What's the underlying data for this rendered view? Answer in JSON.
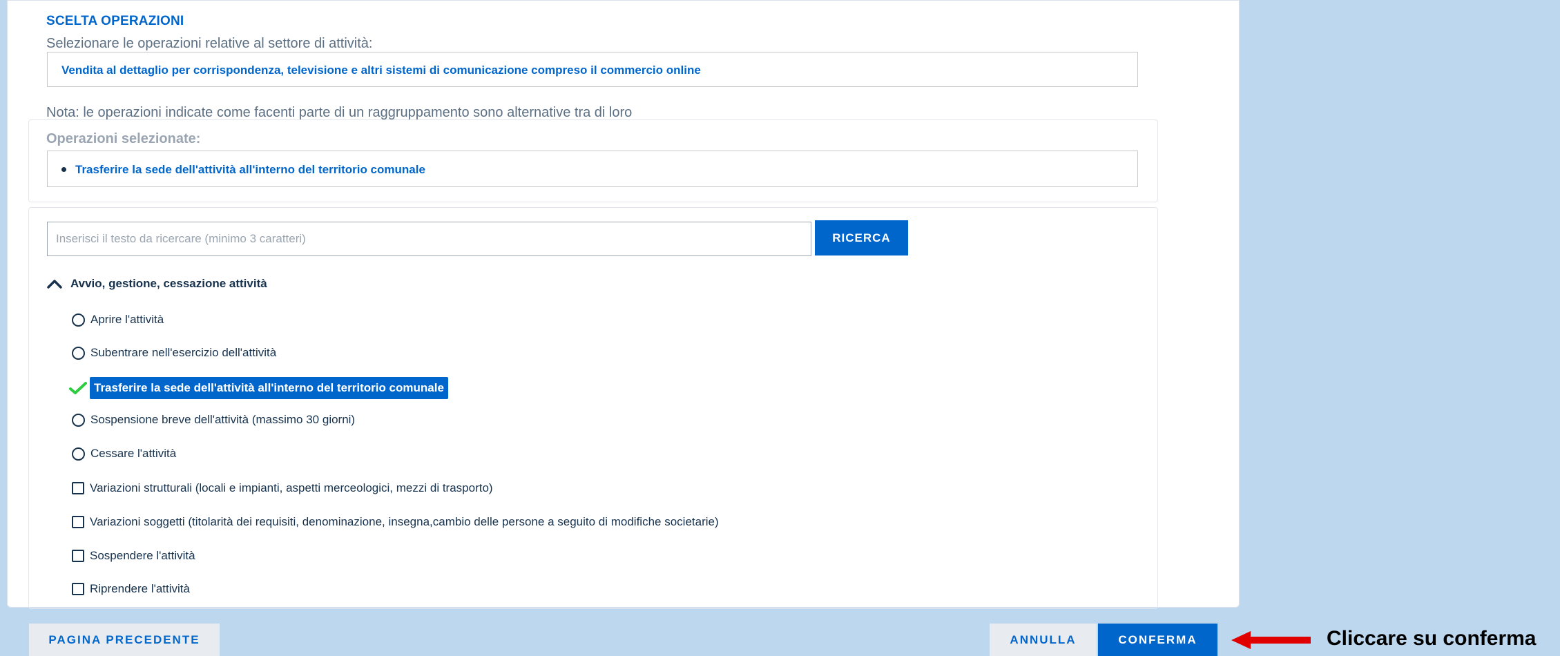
{
  "colors": {
    "primary": "#0066cc",
    "page_background": "#bdd7ee",
    "check_green": "#2ecc40",
    "annotation_arrow": "#e00000"
  },
  "scelta": {
    "title": "SCELTA OPERAZIONI",
    "subtitle": "Selezionare le operazioni relative al settore di attività:",
    "sector": "Vendita al dettaglio per corrispondenza, televisione e altri sistemi di comunicazione compreso il commercio online",
    "nota": "Nota: le operazioni indicate come facenti parte di un raggruppamento sono alternative tra di loro"
  },
  "selected": {
    "title": "Operazioni selezionate:",
    "items": [
      "Trasferire la sede dell'attività all'interno del territorio comunale"
    ]
  },
  "search": {
    "placeholder": "Inserisci il testo da ricercare (minimo 3 caratteri)",
    "value": "",
    "button_label": "RICERCA"
  },
  "group": {
    "label": "Avvio, gestione, cessazione attività",
    "icon": "chevron-up-icon",
    "options": [
      {
        "label": "Aprire l'attività",
        "type": "radio",
        "checked": false
      },
      {
        "label": "Subentrare nell'esercizio dell'attività",
        "type": "radio",
        "checked": false
      },
      {
        "label": "Trasferire la sede dell'attività all'interno del territorio comunale",
        "type": "radio",
        "checked": true
      },
      {
        "label": "Sospensione breve dell'attività (massimo 30 giorni)",
        "type": "radio",
        "checked": false
      },
      {
        "label": "Cessare l'attività",
        "type": "radio",
        "checked": false
      },
      {
        "label": "Variazioni strutturali (locali e impianti, aspetti merceologici, mezzi di trasporto)",
        "type": "checkbox",
        "checked": false
      },
      {
        "label": "Variazioni soggetti (titolarità dei requisiti, denominazione, insegna,cambio delle persone a seguito di modifiche societarie)",
        "type": "checkbox",
        "checked": false
      },
      {
        "label": "Sospendere l'attività",
        "type": "checkbox",
        "checked": false
      },
      {
        "label": "Riprendere l'attività",
        "type": "checkbox",
        "checked": false
      }
    ]
  },
  "footer": {
    "prev_label": "PAGINA PRECEDENTE",
    "cancel_label": "ANNULLA",
    "confirm_label": "CONFERMA"
  },
  "annotation": {
    "text": "Cliccare su conferma",
    "icon": "arrow-left-icon"
  }
}
